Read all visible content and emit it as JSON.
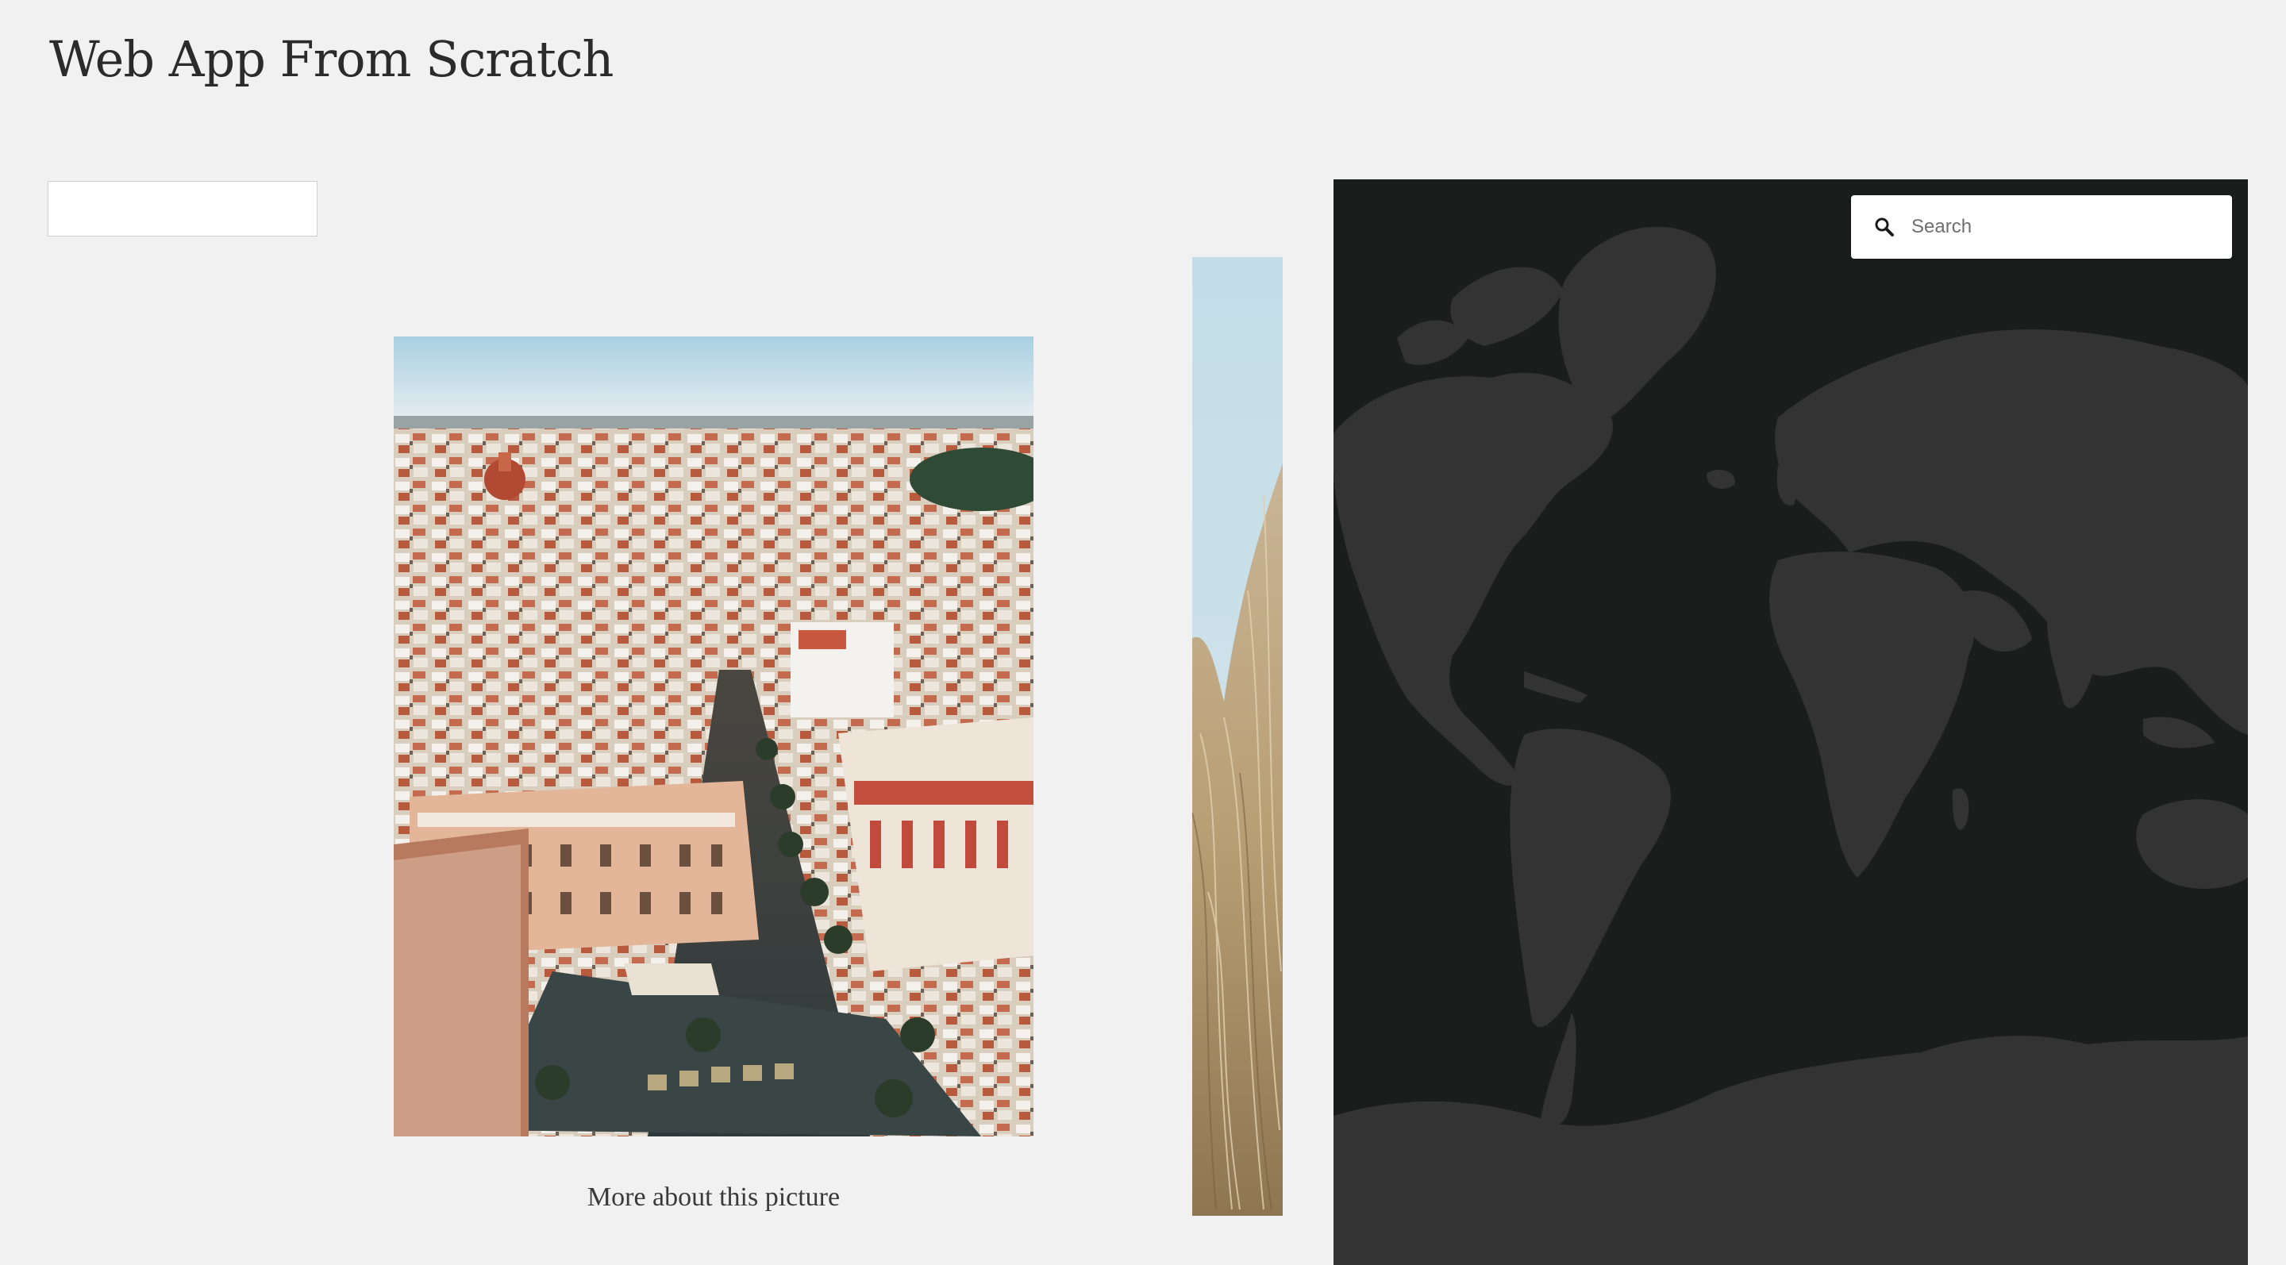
{
  "header": {
    "title": "Web App From Scratch"
  },
  "filter": {
    "value": "",
    "placeholder": ""
  },
  "gallery": {
    "caption": "More about this picture",
    "main_image": "aerial-city-photo",
    "side_image": "dry-grass-photo"
  },
  "map": {
    "search_placeholder": "Search",
    "search_icon": "search-icon",
    "colors": {
      "ocean": "#1b1c1c",
      "land": "#333333"
    }
  }
}
